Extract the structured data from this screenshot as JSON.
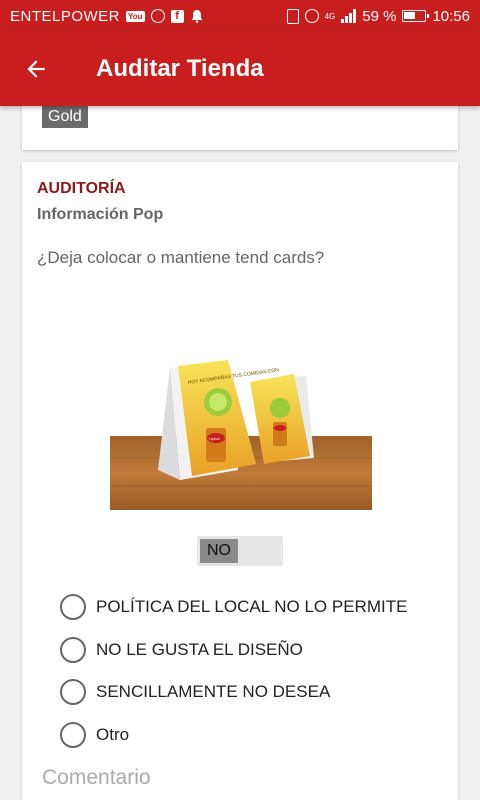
{
  "status_bar": {
    "carrier": "ENTELPOWER",
    "youtube_badge": "YouTube",
    "battery_percent": "59 %",
    "battery_level": 0.59,
    "network": "4G",
    "time": "10:56"
  },
  "app_bar": {
    "title": "Auditar Tienda",
    "back_icon": "arrow-left-icon"
  },
  "store_card": {
    "badge": "Gold"
  },
  "audit": {
    "section_title": "AUDITORÍA",
    "section_subtitle": "Información Pop",
    "question": "¿Deja colocar o mantiene tend cards?",
    "toggle_value": "NO",
    "options": [
      {
        "label": "POLÍTICA DEL LOCAL NO LO PERMITE"
      },
      {
        "label": "NO LE GUSTA EL DISEÑO"
      },
      {
        "label": "SENCILLAMENTE NO DESEA"
      },
      {
        "label": "Otro"
      }
    ],
    "comment_placeholder": "Comentario",
    "comment_value": ""
  },
  "illustration": {
    "card_text": "HOY ACOMPAÑAS TUS COMIDAS CON",
    "brand": "Lipton"
  },
  "colors": {
    "primary": "#c81e1e",
    "section_title": "#8b1a1a",
    "badge_bg": "#6b6b6b"
  }
}
